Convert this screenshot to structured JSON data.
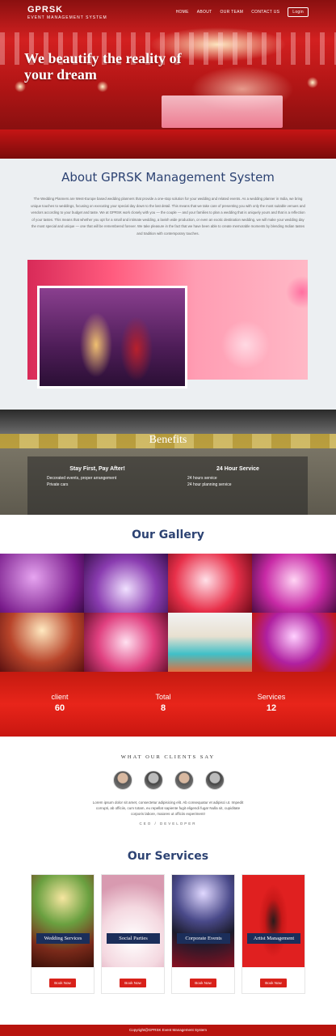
{
  "nav": {
    "brand_name": "GPRSK",
    "brand_sub": "EVENT MANAGEMENT SYSTEM",
    "items": [
      "HOME",
      "ABOUT",
      "OUR TEAM",
      "CONTACT US"
    ],
    "login": "Login"
  },
  "hero": {
    "title": "We beautify the reality of your dream"
  },
  "about": {
    "title": "About GPRSK Management System",
    "text": "The Wedding Planners are West-Europe based wedding planners that provide a one-stop solution for your wedding and related events. As a wedding planner in India, we bring unique touches to weddings, focusing on executing your special day down to the last detail. This means that we take care of presenting you with only the most suitable venues and vendors according to your budget and taste. We at GPRSK work closely with you — the couple — and your families to plan a wedding that is uniquely yours and that is a reflection of your tastes. This means that whether you opt for a small and intimate wedding, a lavish wide production, or even an exotic destination wedding, we will make your wedding day the most special and unique — one that will be remembered forever. We take pleasure in the fact that we have been able to create memorable moments by blending Indian tastes and tradition with contemporary touches."
  },
  "benefits": {
    "title": "Benefits",
    "col1": {
      "title": "Stay First, Pay After!",
      "lines": [
        "Decorated events, proper arrangement",
        "Private cars"
      ]
    },
    "col2": {
      "title": "24 Hour Service",
      "lines": [
        "24 hours service",
        "24 hour planning service"
      ]
    }
  },
  "gallery": {
    "title": "Our Gallery"
  },
  "stats": [
    {
      "label": "client",
      "value": "60"
    },
    {
      "label": "Total",
      "value": "8"
    },
    {
      "label": "Services",
      "value": "12"
    }
  ],
  "testimonials": {
    "heading": "WHAT OUR CLIENTS SAY",
    "quote": "Lorem ipsum dolor sit amet, consectetur adipisicing elit. Ab consequatur et adipisci ut. Impedit corrupti, ab officiis, cum totam, eu repellat sapiente fugit eligendi fuga! Nulla sit, cupiditate corporis labore, maiores ut officiis experiment!",
    "author": "CEO / DEVELOPER"
  },
  "services": {
    "title": "Our Services",
    "cards": [
      {
        "label": "Wedding Services",
        "button": "Book Now"
      },
      {
        "label": "Social Parties",
        "button": "Book Now"
      },
      {
        "label": "Corporate Events",
        "button": "Book Now"
      },
      {
        "label": "Artist Management",
        "button": "Book Now"
      }
    ]
  },
  "footer": {
    "text": "Copyright@GPRSK Event Management System"
  }
}
